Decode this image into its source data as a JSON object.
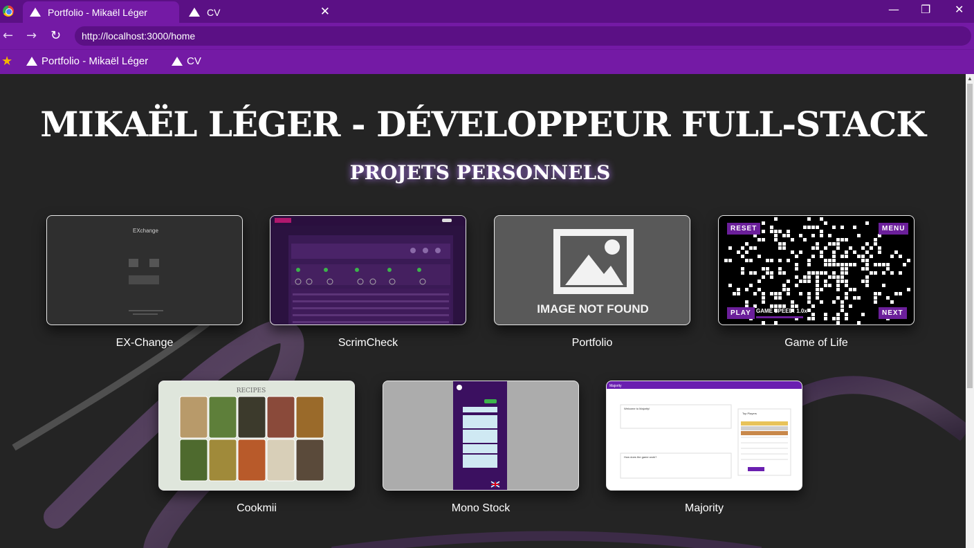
{
  "browser": {
    "tabs": [
      {
        "title": "Portfolio - Mikaël Léger",
        "active": true
      },
      {
        "title": "CV",
        "active": false
      }
    ],
    "url": "http://localhost:3000/home",
    "bookmarks": [
      "Portfolio - Mikaël Léger",
      "CV"
    ],
    "colors": {
      "chrome_dark": "#5b1085",
      "chrome": "#741aa5"
    }
  },
  "page": {
    "title": "MIKAËL LÉGER - DÉVELOPPEUR FULL-STACK",
    "subtitle": "PROJETS PERSONNELS",
    "projects": [
      {
        "name": "EX-Change"
      },
      {
        "name": "ScrimCheck"
      },
      {
        "name": "Portfolio",
        "placeholder_text": "IMAGE NOT FOUND"
      },
      {
        "name": "Game of Life",
        "buttons": {
          "reset": "RESET",
          "menu": "MENU",
          "play": "PLAY",
          "next": "NEXT",
          "speed": "GAME SPEED: 1.0x"
        }
      },
      {
        "name": "Cookmii",
        "thumb_title": "RECIPES"
      },
      {
        "name": "Mono Stock"
      },
      {
        "name": "Majority"
      }
    ],
    "thumb_texts": {
      "exchange_logo": "EXchange",
      "maj_brand": "Majority",
      "maj_welcome": "Welcome to Majority!",
      "maj_top": "Top Players",
      "maj_how": "How does the game work?"
    }
  }
}
